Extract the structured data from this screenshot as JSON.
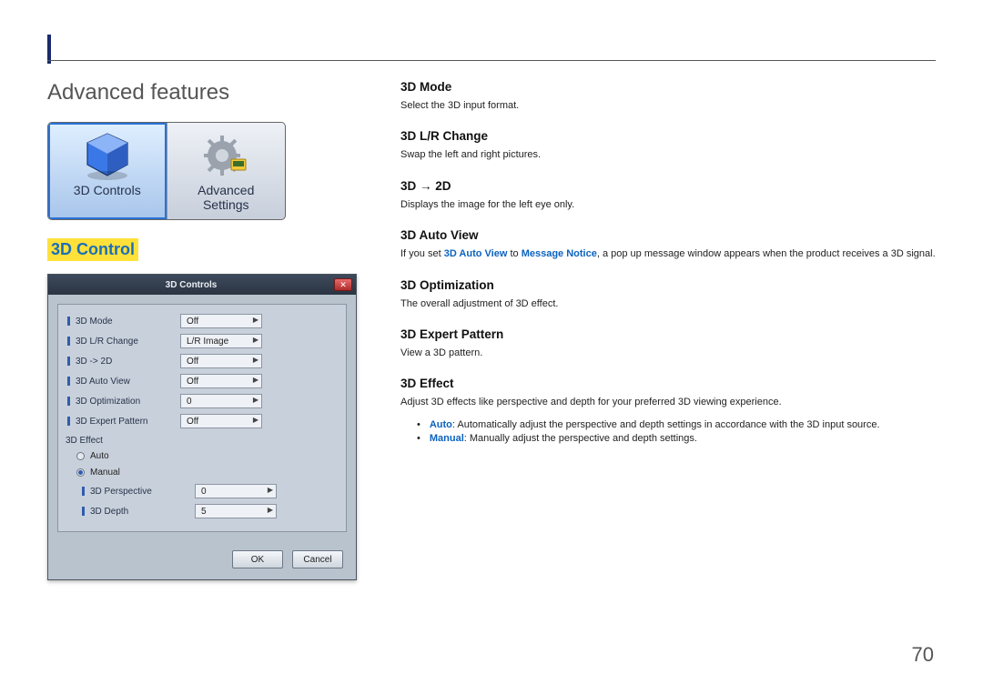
{
  "page": {
    "sectionTitle": "Advanced features",
    "highlightHeading": "3D Control",
    "pageNumber": "70"
  },
  "tiles": {
    "left": {
      "caption": "3D Controls"
    },
    "right": {
      "captionLine1": "Advanced",
      "captionLine2": "Settings"
    }
  },
  "dialog": {
    "title": "3D Controls",
    "rows": {
      "mode": {
        "label": "3D Mode",
        "value": "Off"
      },
      "lrchange": {
        "label": "3D L/R Change",
        "value": "L/R Image"
      },
      "to2d": {
        "label": "3D -> 2D",
        "value": "Off"
      },
      "autoview": {
        "label": "3D Auto View",
        "value": "Off"
      },
      "optimization": {
        "label": "3D Optimization",
        "value": "0"
      },
      "expert": {
        "label": "3D Expert Pattern",
        "value": "Off"
      }
    },
    "effect": {
      "heading": "3D Effect",
      "radioAuto": "Auto",
      "radioManual": "Manual",
      "perspective": {
        "label": "3D Perspective",
        "value": "0"
      },
      "depth": {
        "label": "3D Depth",
        "value": "5"
      }
    },
    "buttons": {
      "ok": "OK",
      "cancel": "Cancel"
    }
  },
  "right": {
    "mode": {
      "h": "3D Mode",
      "d": "Select the 3D input format."
    },
    "lrchange": {
      "h": "3D L/R Change",
      "d": "Swap the left and right pictures."
    },
    "to2d": {
      "h": "3D → 2D",
      "d": "Displays the image for the left eye only."
    },
    "autoview": {
      "h": "3D Auto View",
      "pre": "If you set ",
      "kw1": "3D Auto View",
      "mid": " to ",
      "kw2": "Message Notice",
      "post": ", a pop up message window appears when the product receives a 3D signal."
    },
    "optimization": {
      "h": "3D Optimization",
      "d": "The overall adjustment of 3D effect."
    },
    "expert": {
      "h": "3D Expert Pattern",
      "d": "View a 3D pattern."
    },
    "effect": {
      "h": "3D Effect",
      "d": "Adjust 3D effects like perspective and depth for your preferred 3D viewing experience.",
      "autoKw": "Auto",
      "autoTxt": ": Automatically adjust the perspective and depth settings in accordance with the 3D input source.",
      "manKw": "Manual",
      "manTxt": ": Manually adjust the perspective and depth settings."
    }
  }
}
